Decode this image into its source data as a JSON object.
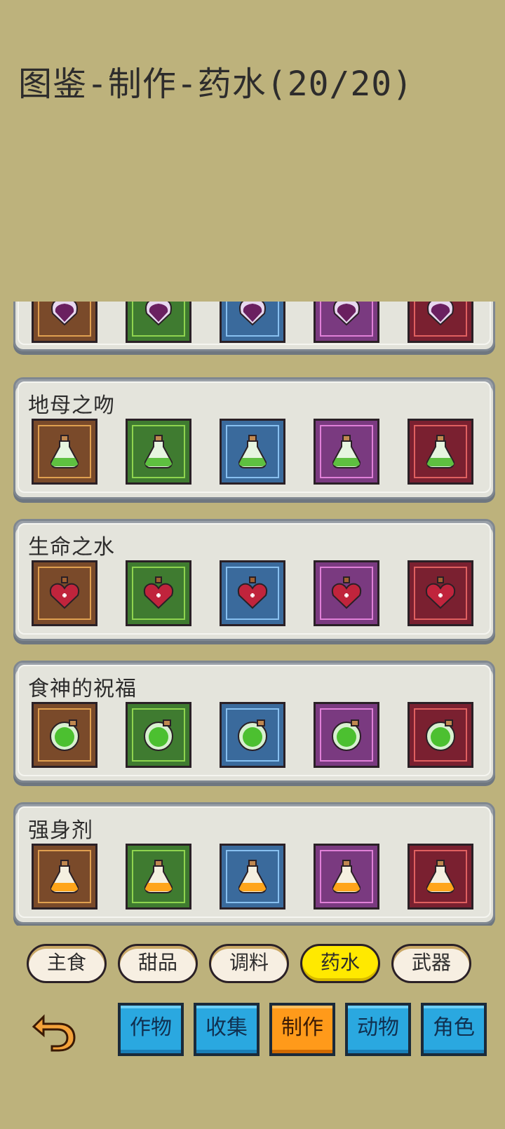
{
  "title": "图鉴-制作-药水(20/20)",
  "groups": [
    {
      "name": "",
      "potion": "purple-shield-potion-icon",
      "liquid": "#6a2060",
      "glass": "#e8d8f0"
    },
    {
      "name": "地母之吻",
      "potion": "green-flask-potion-icon",
      "liquid": "#5ec040",
      "glass": "#e6f5e0"
    },
    {
      "name": "生命之水",
      "potion": "red-heart-potion-icon",
      "liquid": "#c0243c",
      "glass": "#f0d0d8"
    },
    {
      "name": "食神的祝福",
      "potion": "green-orb-potion-icon",
      "liquid": "#4cc030",
      "glass": "#d8f0d0"
    },
    {
      "name": "强身剂",
      "potion": "orange-flask-potion-icon",
      "liquid": "#ffa51a",
      "glass": "#f5f0e0"
    }
  ],
  "slot_colors": [
    "brown",
    "green",
    "blue",
    "purple",
    "red"
  ],
  "category_tabs": [
    "主食",
    "甜品",
    "调料",
    "药水",
    "武器"
  ],
  "active_category": "药水",
  "main_tabs": [
    "作物",
    "收集",
    "制作",
    "动物",
    "角色"
  ],
  "active_main": "制作",
  "icons": {
    "back": "undo-arrow-icon"
  }
}
